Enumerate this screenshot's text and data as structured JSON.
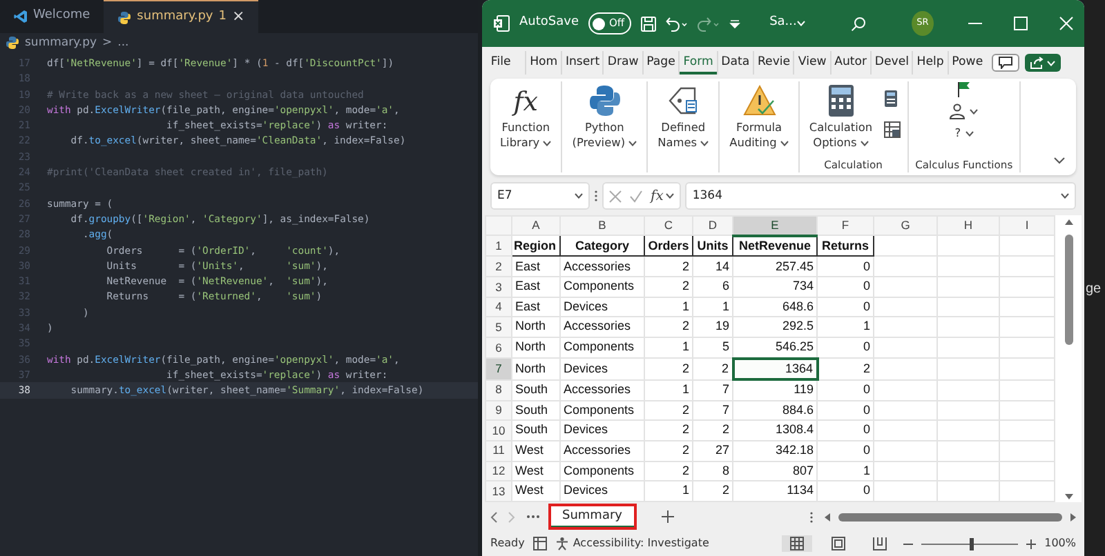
{
  "editor": {
    "tabs": [
      {
        "label": "Welcome",
        "kind": "vscode",
        "selected": false
      },
      {
        "label": "summary.py",
        "badge": "1",
        "close": "×",
        "kind": "python",
        "selected": true
      }
    ],
    "breadcrumb": [
      "summary.py",
      ">",
      "..."
    ],
    "lines": [
      {
        "number": "17",
        "current": false,
        "tokens": [
          {
            "t": "df[",
            "kind": "plain"
          },
          {
            "t": "'NetRevenue'",
            "kind": "string"
          },
          {
            "t": "] = df[",
            "kind": "plain"
          },
          {
            "t": "'Revenue'",
            "kind": "string"
          },
          {
            "t": "] * (",
            "kind": "plain"
          },
          {
            "t": "1",
            "kind": "number"
          },
          {
            "t": " - df[",
            "kind": "plain"
          },
          {
            "t": "'DiscountPct'",
            "kind": "string"
          },
          {
            "t": "])",
            "kind": "plain"
          }
        ]
      },
      {
        "number": "18",
        "current": false
      },
      {
        "number": "19",
        "current": false,
        "tokens": [
          {
            "t": "# Write back as a new sheet — original data untouched",
            "kind": "comment"
          }
        ]
      },
      {
        "number": "20",
        "current": false,
        "tokens": [
          {
            "t": "with",
            "kind": "keyword"
          },
          {
            "t": " pd.",
            "kind": "plain"
          },
          {
            "t": "ExcelWriter",
            "kind": "func"
          },
          {
            "t": "(file_path, engine=",
            "kind": "plain"
          },
          {
            "t": "'openpyxl'",
            "kind": "string"
          },
          {
            "t": ", mode=",
            "kind": "plain"
          },
          {
            "t": "'a'",
            "kind": "string"
          },
          {
            "t": ",",
            "kind": "plain"
          }
        ]
      },
      {
        "number": "21",
        "current": false,
        "tokens": [
          {
            "t": "                    if_sheet_exists=",
            "kind": "plain"
          },
          {
            "t": "'replace'",
            "kind": "string"
          },
          {
            "t": ") ",
            "kind": "plain"
          },
          {
            "t": "as",
            "kind": "keyword"
          },
          {
            "t": " writer:",
            "kind": "plain"
          }
        ]
      },
      {
        "number": "22",
        "current": false,
        "tokens": [
          {
            "t": "    df.",
            "kind": "plain"
          },
          {
            "t": "to_excel",
            "kind": "func"
          },
          {
            "t": "(writer, sheet_name=",
            "kind": "plain"
          },
          {
            "t": "'CleanData'",
            "kind": "string"
          },
          {
            "t": ", index=False)",
            "kind": "plain"
          }
        ]
      },
      {
        "number": "23",
        "current": false
      },
      {
        "number": "24",
        "current": false,
        "tokens": [
          {
            "t": "#print('CleanData sheet created in', file_path)",
            "kind": "comment"
          }
        ]
      },
      {
        "number": "25",
        "current": false
      },
      {
        "number": "26",
        "current": false,
        "tokens": [
          {
            "t": "summary = (",
            "kind": "plain"
          }
        ]
      },
      {
        "number": "27",
        "current": false,
        "tokens": [
          {
            "t": "    df.",
            "kind": "plain"
          },
          {
            "t": "groupby",
            "kind": "func"
          },
          {
            "t": "([",
            "kind": "plain"
          },
          {
            "t": "'Region'",
            "kind": "string"
          },
          {
            "t": ", ",
            "kind": "plain"
          },
          {
            "t": "'Category'",
            "kind": "string"
          },
          {
            "t": "], as_index=False)",
            "kind": "plain"
          }
        ]
      },
      {
        "number": "28",
        "current": false,
        "tokens": [
          {
            "t": "      .",
            "kind": "plain"
          },
          {
            "t": "agg",
            "kind": "func"
          },
          {
            "t": "(",
            "kind": "plain"
          }
        ]
      },
      {
        "number": "29",
        "current": false,
        "tokens": [
          {
            "t": "          Orders      = (",
            "kind": "plain"
          },
          {
            "t": "'OrderID'",
            "kind": "string"
          },
          {
            "t": ",     ",
            "kind": "plain"
          },
          {
            "t": "'count'",
            "kind": "string"
          },
          {
            "t": "),",
            "kind": "plain"
          }
        ]
      },
      {
        "number": "30",
        "current": false,
        "tokens": [
          {
            "t": "          Units       = (",
            "kind": "plain"
          },
          {
            "t": "'Units'",
            "kind": "string"
          },
          {
            "t": ",       ",
            "kind": "plain"
          },
          {
            "t": "'sum'",
            "kind": "string"
          },
          {
            "t": "),",
            "kind": "plain"
          }
        ]
      },
      {
        "number": "31",
        "current": false,
        "tokens": [
          {
            "t": "          NetRevenue  = (",
            "kind": "plain"
          },
          {
            "t": "'NetRevenue'",
            "kind": "string"
          },
          {
            "t": ",  ",
            "kind": "plain"
          },
          {
            "t": "'sum'",
            "kind": "string"
          },
          {
            "t": "),",
            "kind": "plain"
          }
        ]
      },
      {
        "number": "32",
        "current": false,
        "tokens": [
          {
            "t": "          Returns     = (",
            "kind": "plain"
          },
          {
            "t": "'Returned'",
            "kind": "string"
          },
          {
            "t": ",    ",
            "kind": "plain"
          },
          {
            "t": "'sum'",
            "kind": "string"
          },
          {
            "t": ")",
            "kind": "plain"
          }
        ]
      },
      {
        "number": "33",
        "current": false,
        "tokens": [
          {
            "t": "      )",
            "kind": "plain"
          }
        ]
      },
      {
        "number": "34",
        "current": false,
        "tokens": [
          {
            "t": ")",
            "kind": "plain"
          }
        ]
      },
      {
        "number": "35",
        "current": false
      },
      {
        "number": "36",
        "current": false,
        "tokens": [
          {
            "t": "with",
            "kind": "keyword"
          },
          {
            "t": " pd.",
            "kind": "plain"
          },
          {
            "t": "ExcelWriter",
            "kind": "func"
          },
          {
            "t": "(file_path, engine=",
            "kind": "plain"
          },
          {
            "t": "'openpyxl'",
            "kind": "string"
          },
          {
            "t": ", mode=",
            "kind": "plain"
          },
          {
            "t": "'a'",
            "kind": "string"
          },
          {
            "t": ",",
            "kind": "plain"
          }
        ]
      },
      {
        "number": "37",
        "current": false,
        "tokens": [
          {
            "t": "                    if_sheet_exists=",
            "kind": "plain"
          },
          {
            "t": "'replace'",
            "kind": "string"
          },
          {
            "t": ") ",
            "kind": "plain"
          },
          {
            "t": "as",
            "kind": "keyword"
          },
          {
            "t": " writer:",
            "kind": "plain"
          }
        ]
      },
      {
        "number": "38",
        "current": true,
        "tokens": [
          {
            "t": "    summary.",
            "kind": "plain"
          },
          {
            "t": "to_excel",
            "kind": "func"
          },
          {
            "t": "(writer, sheet_name=",
            "kind": "plain"
          },
          {
            "t": "'Summary'",
            "kind": "string"
          },
          {
            "t": ", index=False)",
            "kind": "plain"
          }
        ]
      }
    ]
  },
  "excel": {
    "title_bar": {
      "autosave_label": "AutoSave",
      "autosave": {
        "label": "Off",
        "on": false
      },
      "file_name": "Sa...",
      "avatar": "SR"
    },
    "ribbon_tabs": [
      {
        "label": "File",
        "selected": false
      },
      {
        "label": "Hom",
        "selected": false
      },
      {
        "label": "Insert",
        "selected": false
      },
      {
        "label": "Draw",
        "selected": false
      },
      {
        "label": "Page",
        "selected": false
      },
      {
        "label": "Form",
        "selected": true
      },
      {
        "label": "Data",
        "selected": false
      },
      {
        "label": "Revie",
        "selected": false
      },
      {
        "label": "View",
        "selected": false
      },
      {
        "label": "Autor",
        "selected": false
      },
      {
        "label": "Devel",
        "selected": false
      },
      {
        "label": "Help",
        "selected": false
      },
      {
        "label": "Powe",
        "selected": false
      }
    ],
    "ribbon_groups": [
      {
        "items": [
          {
            "kind": "fx",
            "glyph": "fx",
            "lines": [
              "Function",
              "Library"
            ]
          }
        ]
      },
      {
        "items": [
          {
            "kind": "python",
            "lines": [
              "Python",
              "(Preview)"
            ]
          }
        ]
      },
      {
        "items": [
          {
            "kind": "names",
            "lines": [
              "Defined",
              "Names"
            ]
          }
        ]
      },
      {
        "items": [
          {
            "kind": "auditing",
            "lines": [
              "Formula",
              "Auditing"
            ]
          }
        ]
      },
      {
        "label": "Calculation",
        "items": [
          {
            "kind": "calculator",
            "lines": [
              "Calculation",
              "Options"
            ]
          },
          {
            "kind": "small-calc"
          }
        ]
      },
      {
        "label": "Calculus Functions",
        "items": [
          {
            "kind": "flag"
          },
          {
            "kind": "figure"
          },
          {
            "kind": "help",
            "glyph": "?"
          }
        ]
      }
    ],
    "formula_bar": {
      "name_box": "E7",
      "fx": "fx",
      "value": "1364"
    },
    "columns": [
      {
        "label": "A",
        "selected": false
      },
      {
        "label": "B",
        "selected": false
      },
      {
        "label": "C",
        "selected": false
      },
      {
        "label": "D",
        "selected": false
      },
      {
        "label": "E",
        "selected": true
      },
      {
        "label": "F",
        "selected": false
      },
      {
        "label": "G",
        "selected": false
      },
      {
        "label": "H",
        "selected": false
      },
      {
        "label": "I",
        "selected": false
      }
    ],
    "rows": [
      {
        "number": "1",
        "kind": "header",
        "selected": false,
        "cells": [
          {
            "v": "Region",
            "selected": false
          },
          {
            "v": "Category",
            "selected": false
          },
          {
            "v": "Orders",
            "selected": false
          },
          {
            "v": "Units",
            "selected": false
          },
          {
            "v": "NetRevenue",
            "selected": false
          },
          {
            "v": "Returns",
            "selected": false
          }
        ]
      },
      {
        "number": "2",
        "kind": "data",
        "selected": false,
        "cells": [
          {
            "v": "East",
            "selected": false
          },
          {
            "v": "Accessories",
            "selected": false
          },
          {
            "v": "2",
            "selected": false
          },
          {
            "v": "14",
            "selected": false
          },
          {
            "v": "257.45",
            "selected": false
          },
          {
            "v": "0",
            "selected": false
          }
        ]
      },
      {
        "number": "3",
        "kind": "data",
        "selected": false,
        "cells": [
          {
            "v": "East",
            "selected": false
          },
          {
            "v": "Components",
            "selected": false
          },
          {
            "v": "2",
            "selected": false
          },
          {
            "v": "6",
            "selected": false
          },
          {
            "v": "734",
            "selected": false
          },
          {
            "v": "0",
            "selected": false
          }
        ]
      },
      {
        "number": "4",
        "kind": "data",
        "selected": false,
        "cells": [
          {
            "v": "East",
            "selected": false
          },
          {
            "v": "Devices",
            "selected": false
          },
          {
            "v": "1",
            "selected": false
          },
          {
            "v": "1",
            "selected": false
          },
          {
            "v": "648.6",
            "selected": false
          },
          {
            "v": "0",
            "selected": false
          }
        ]
      },
      {
        "number": "5",
        "kind": "data",
        "selected": false,
        "cells": [
          {
            "v": "North",
            "selected": false
          },
          {
            "v": "Accessories",
            "selected": false
          },
          {
            "v": "2",
            "selected": false
          },
          {
            "v": "19",
            "selected": false
          },
          {
            "v": "292.5",
            "selected": false
          },
          {
            "v": "1",
            "selected": false
          }
        ]
      },
      {
        "number": "6",
        "kind": "data",
        "selected": false,
        "cells": [
          {
            "v": "North",
            "selected": false
          },
          {
            "v": "Components",
            "selected": false
          },
          {
            "v": "1",
            "selected": false
          },
          {
            "v": "5",
            "selected": false
          },
          {
            "v": "546.25",
            "selected": false
          },
          {
            "v": "0",
            "selected": false
          }
        ]
      },
      {
        "number": "7",
        "kind": "data",
        "selected": true,
        "cells": [
          {
            "v": "North",
            "selected": false
          },
          {
            "v": "Devices",
            "selected": false
          },
          {
            "v": "2",
            "selected": false
          },
          {
            "v": "2",
            "selected": false
          },
          {
            "v": "1364",
            "selected": true
          },
          {
            "v": "2",
            "selected": false
          }
        ]
      },
      {
        "number": "8",
        "kind": "data",
        "selected": false,
        "cells": [
          {
            "v": "South",
            "selected": false
          },
          {
            "v": "Accessories",
            "selected": false
          },
          {
            "v": "1",
            "selected": false
          },
          {
            "v": "7",
            "selected": false
          },
          {
            "v": "119",
            "selected": false
          },
          {
            "v": "0",
            "selected": false
          }
        ]
      },
      {
        "number": "9",
        "kind": "data",
        "selected": false,
        "cells": [
          {
            "v": "South",
            "selected": false
          },
          {
            "v": "Components",
            "selected": false
          },
          {
            "v": "2",
            "selected": false
          },
          {
            "v": "7",
            "selected": false
          },
          {
            "v": "884.6",
            "selected": false
          },
          {
            "v": "0",
            "selected": false
          }
        ]
      },
      {
        "number": "10",
        "kind": "data",
        "selected": false,
        "cells": [
          {
            "v": "South",
            "selected": false
          },
          {
            "v": "Devices",
            "selected": false
          },
          {
            "v": "2",
            "selected": false
          },
          {
            "v": "2",
            "selected": false
          },
          {
            "v": "1308.4",
            "selected": false
          },
          {
            "v": "0",
            "selected": false
          }
        ]
      },
      {
        "number": "11",
        "kind": "data",
        "selected": false,
        "cells": [
          {
            "v": "West",
            "selected": false
          },
          {
            "v": "Accessories",
            "selected": false
          },
          {
            "v": "2",
            "selected": false
          },
          {
            "v": "27",
            "selected": false
          },
          {
            "v": "342.18",
            "selected": false
          },
          {
            "v": "0",
            "selected": false
          }
        ]
      },
      {
        "number": "12",
        "kind": "data",
        "selected": false,
        "cells": [
          {
            "v": "West",
            "selected": false
          },
          {
            "v": "Components",
            "selected": false
          },
          {
            "v": "2",
            "selected": false
          },
          {
            "v": "8",
            "selected": false
          },
          {
            "v": "807",
            "selected": false
          },
          {
            "v": "1",
            "selected": false
          }
        ]
      },
      {
        "number": "13",
        "kind": "data",
        "selected": false,
        "cells": [
          {
            "v": "West",
            "selected": false
          },
          {
            "v": "Devices",
            "selected": false
          },
          {
            "v": "1",
            "selected": false
          },
          {
            "v": "2",
            "selected": false
          },
          {
            "v": "1134",
            "selected": false
          },
          {
            "v": "0",
            "selected": false
          }
        ]
      }
    ],
    "sheet_tabs": [
      {
        "label": "Summary",
        "selected": true,
        "outlined": true
      }
    ],
    "status_bar": {
      "state": "Ready",
      "accessibility": "Accessibility: Investigate",
      "views": [
        {
          "kind": "normal",
          "selected": true
        },
        {
          "kind": "page-layout",
          "selected": false
        },
        {
          "kind": "page-break",
          "selected": false
        }
      ],
      "zoom": {
        "level": 0.5,
        "reading": "100%"
      }
    }
  },
  "background_window": {
    "fragment": "ge"
  }
}
